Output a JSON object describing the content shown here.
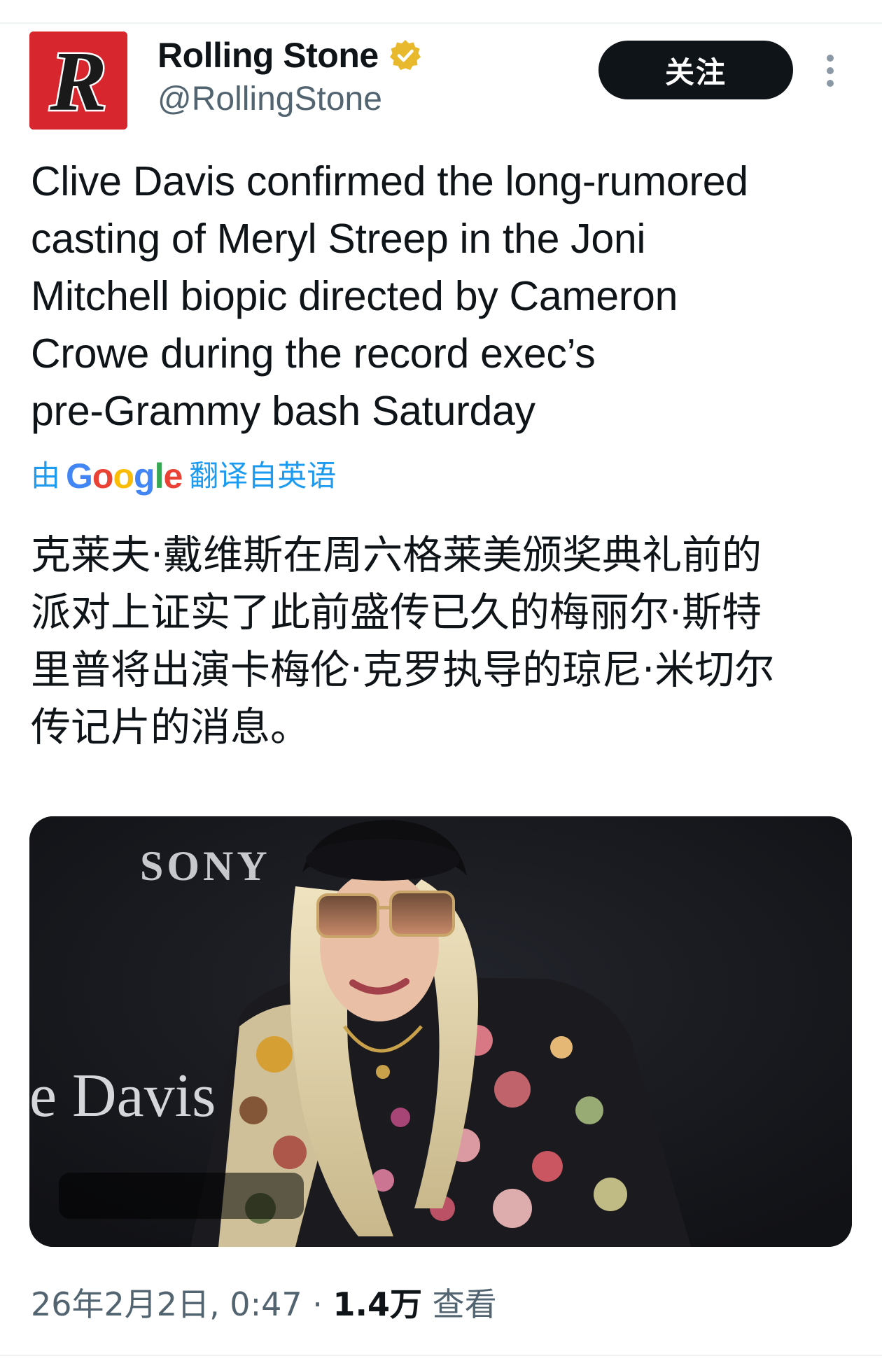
{
  "author": {
    "avatar_letter": "R",
    "display_name": "Rolling Stone",
    "handle": "@RollingStone",
    "verified_icon": "gold-checkmark-badge",
    "verified_color": "#e8b82d"
  },
  "actions": {
    "follow_label": "关注",
    "more_icon": "vertical-ellipsis"
  },
  "tweet": {
    "text": "Clive Davis confirmed the long-rumored\ncasting of Meryl Streep in the Joni\nMitchell biopic directed by Cameron\nCrowe during the record exec’s\npre-Grammy bash Saturday",
    "translation_prefix": "由",
    "translation_google": "Google",
    "translation_suffix": "翻译自英语",
    "translated_text": "克莱夫·戴维斯在周六格莱美颁奖典礼前的\n派对上证实了此前盛传已久的梅丽尔·斯特\n里普将出演卡梅伦·克罗执导的琼尼·米切尔\n传记片的消息。"
  },
  "media": {
    "backdrop_logo": "SONY",
    "backdrop_text": "e Davis"
  },
  "meta": {
    "datetime": "26年2月2日, 0:47",
    "separator": " · ",
    "views": "1.4万",
    "views_label": " 查看"
  },
  "colors": {
    "accent": "#1d9bf0",
    "text": "#0f1419",
    "secondary": "#536471",
    "follow_bg": "#0f1419"
  }
}
